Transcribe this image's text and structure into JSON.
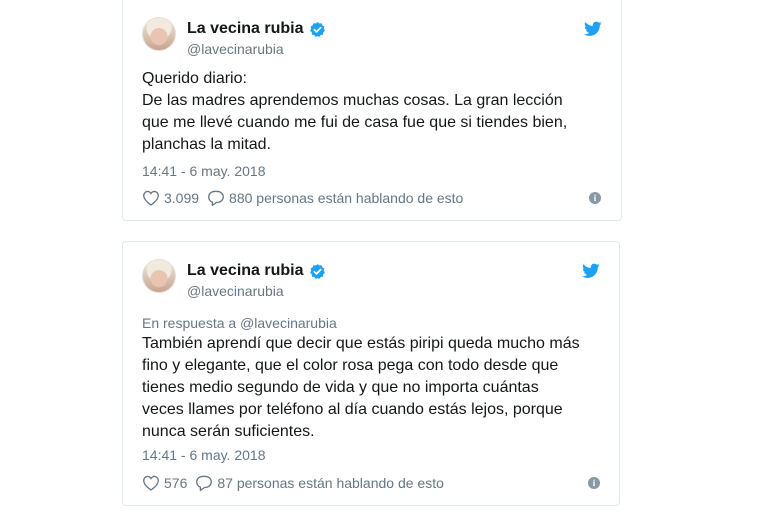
{
  "tweets": [
    {
      "name": "La vecina rubia",
      "handle": "@lavecinarubia",
      "reply_to": "",
      "text": "Querido diario:\nDe las madres aprendemos muchas cosas. La gran lección que me llevé  cuando me fui de casa fue que si tiendes bien, planchas la mitad.",
      "time": "14:41 - 6 may. 2018",
      "likes": "3.099",
      "talking": "880 personas están hablando de esto"
    },
    {
      "name": "La vecina rubia",
      "handle": "@lavecinarubia",
      "reply_to": "En respuesta a @lavecinarubia",
      "text": "También aprendí que decir que estás piripi queda mucho más fino y elegante, que el color rosa pega con todo desde que tienes medio  segundo de vida y que no importa cuántas veces llames por teléfono al  día cuando estás lejos, porque nunca serán suficientes.",
      "time": "14:41 - 6 may. 2018",
      "likes": "576",
      "talking": "87 personas están hablando de esto"
    }
  ],
  "icons": {
    "verified": "verified-badge-icon",
    "brand": "twitter-bird-icon",
    "like": "heart-icon",
    "reply": "speech-bubble-icon",
    "info": "info-icon"
  },
  "colors": {
    "twitter_blue": "#1da1f2",
    "secondary_text": "#657786",
    "border": "#e1e8ed"
  }
}
